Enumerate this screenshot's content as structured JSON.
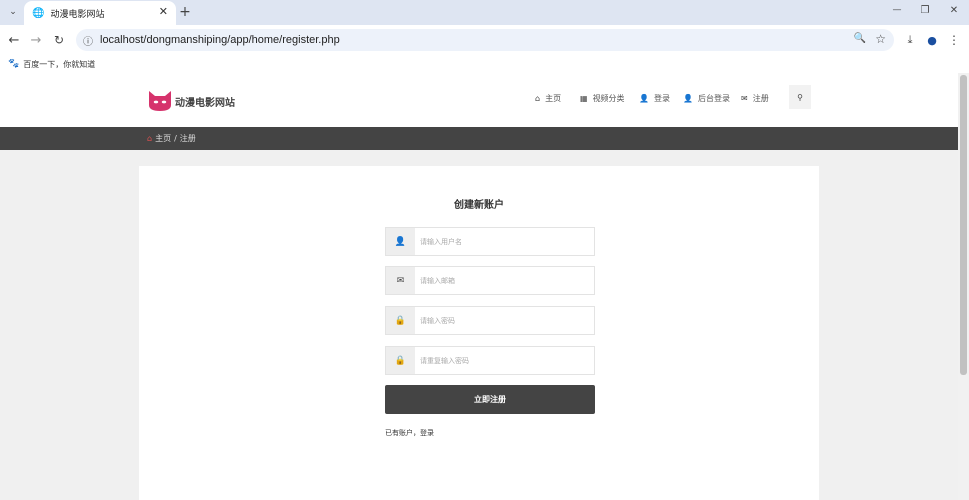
{
  "browser": {
    "tab_title": "动漫电影网站",
    "tab_close": "✕",
    "new_tab": "+",
    "url": "localhost/dongmanshiping/app/home/register.php",
    "bookmark": "百度一下，你就知道",
    "window_controls": [
      "—",
      "❐",
      "✕"
    ]
  },
  "site": {
    "logo_text": "动漫电影网站",
    "nav": [
      {
        "icon": "home-icon",
        "label": "主页"
      },
      {
        "icon": "grid-icon",
        "label": "视频分类"
      },
      {
        "icon": "user-icon",
        "label": "登录"
      },
      {
        "icon": "user-icon",
        "label": "后台登录"
      },
      {
        "icon": "envelope-icon",
        "label": "注册"
      }
    ],
    "breadcrumb": {
      "home": "主页",
      "sep": "/",
      "current": "注册"
    }
  },
  "form": {
    "title": "创建新账户",
    "fields": [
      {
        "icon": "user-icon",
        "placeholder": "请输入用户名"
      },
      {
        "icon": "envelope-icon",
        "placeholder": "请输入邮箱"
      },
      {
        "icon": "lock-icon",
        "placeholder": "请输入密码"
      },
      {
        "icon": "lock-icon",
        "placeholder": "请重复输入密码"
      }
    ],
    "submit": "立即注册",
    "login_prefix": "已有账户，",
    "login_link": "登录"
  },
  "colors": {
    "accent": "#d6336c",
    "dark": "#444444"
  }
}
